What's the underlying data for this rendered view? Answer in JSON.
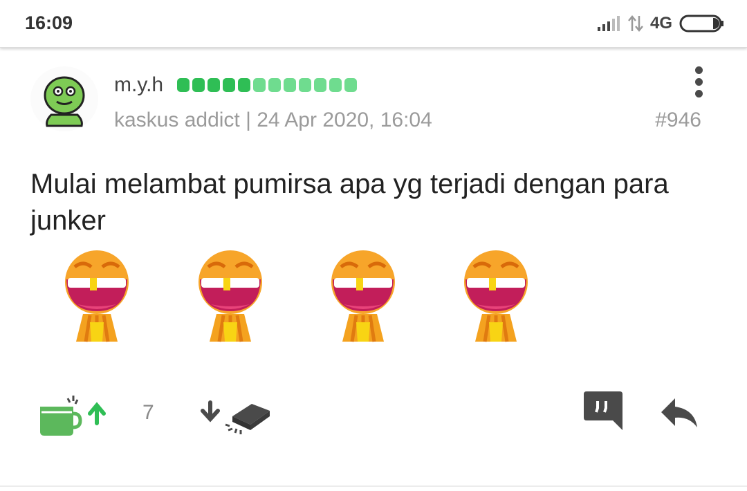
{
  "status_bar": {
    "time": "16:09",
    "network": "4G"
  },
  "post": {
    "username": "m.y.h",
    "reputation": {
      "total": 12,
      "filled": 5
    },
    "rank": "kaskus addict",
    "separator": "|",
    "date": "24 Apr 2020, 16:04",
    "post_number": "#946",
    "content": "Mulai melambat pumirsa apa yg terjadi dengan para junker",
    "emoticons": [
      "laugh-emoticon",
      "laugh-emoticon",
      "laugh-emoticon",
      "laugh-emoticon"
    ]
  },
  "actions": {
    "vote_count": "7"
  },
  "colors": {
    "reputation_dark": "#2fbe55",
    "reputation_light": "#6fdc8f",
    "upvote": "#2fbe55",
    "meta_gray": "#9b9b9b"
  }
}
